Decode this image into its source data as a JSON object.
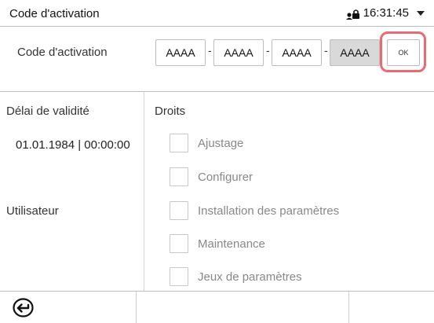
{
  "header": {
    "title": "Code d'activation",
    "time": "16:31:45",
    "status_icons": [
      "user-lock-icon",
      "dropdown-arrow-icon"
    ]
  },
  "activation": {
    "label": "Code d'activation",
    "fields": [
      "AAAA",
      "AAAA",
      "AAAA",
      "AAAA"
    ],
    "separator": "-",
    "active_field_index": 3,
    "ok_label": "OK"
  },
  "validity": {
    "label": "Délai de validité",
    "value": "01.01.1984 | 00:00:00"
  },
  "user": {
    "label": "Utilisateur"
  },
  "rights": {
    "heading": "Droits",
    "items": [
      {
        "label": "Ajustage",
        "checked": false
      },
      {
        "label": "Configurer",
        "checked": false
      },
      {
        "label": "Installation des paramètres",
        "checked": false
      },
      {
        "label": "Maintenance",
        "checked": false
      },
      {
        "label": "Jeux de paramètres",
        "checked": false
      }
    ]
  },
  "footer": {
    "back_icon": "back-arrow-circle-icon"
  },
  "colors": {
    "highlight": "#e86b72",
    "active_field": "#d9d9d9",
    "border": "#bdbdbd",
    "disabled_text": "#888888"
  }
}
